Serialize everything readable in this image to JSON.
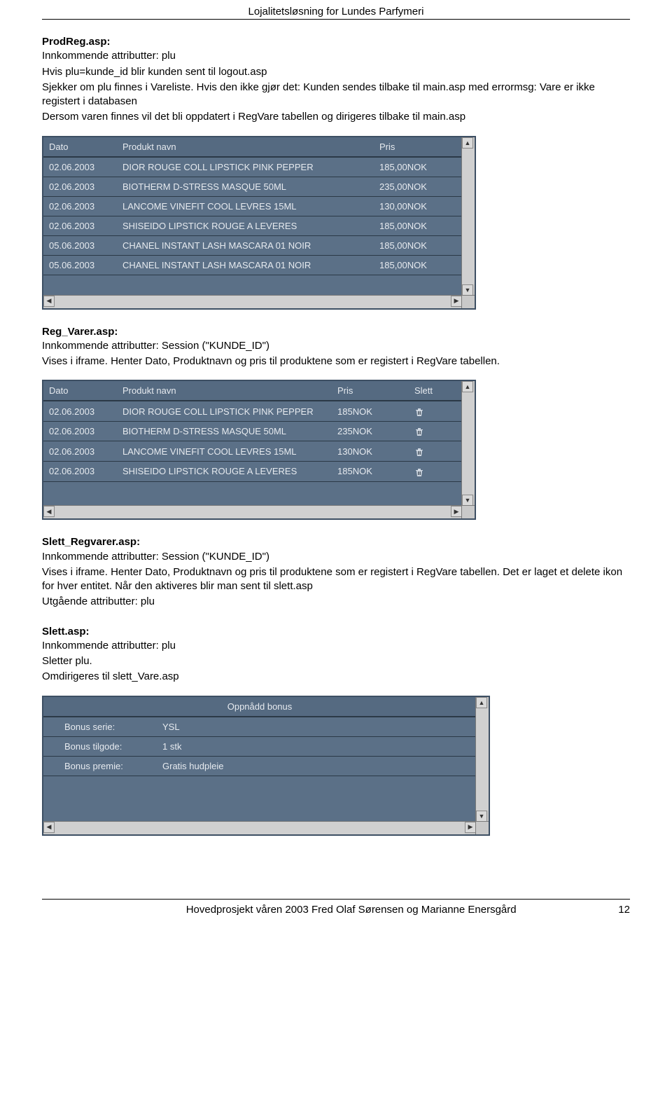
{
  "header": {
    "title": "Lojalitetsløsning for Lundes Parfymeri"
  },
  "section1": {
    "title": "ProdReg.asp:",
    "lines": [
      "Innkommende attributter: plu",
      "Hvis plu=kunde_id blir kunden sent til logout.asp",
      "Sjekker om plu finnes i Vareliste. Hvis den ikke gjør det: Kunden sendes tilbake til main.asp med errormsg: Vare er ikke registert i databasen",
      "Dersom varen finnes vil det bli oppdatert i RegVare tabellen og dirigeres tilbake til main.asp"
    ]
  },
  "table1": {
    "headers": {
      "dato": "Dato",
      "navn": "Produkt navn",
      "pris": "Pris"
    },
    "rows": [
      {
        "dato": "02.06.2003",
        "navn": "DIOR ROUGE COLL LIPSTICK PINK PEPPER",
        "pris": "185,00NOK"
      },
      {
        "dato": "02.06.2003",
        "navn": "BIOTHERM D-STRESS MASQUE 50ML",
        "pris": "235,00NOK"
      },
      {
        "dato": "02.06.2003",
        "navn": "LANCOME VINEFIT COOL LEVRES 15ML",
        "pris": "130,00NOK"
      },
      {
        "dato": "02.06.2003",
        "navn": "SHISEIDO LIPSTICK ROUGE A LEVERES",
        "pris": "185,00NOK"
      },
      {
        "dato": "05.06.2003",
        "navn": "CHANEL INSTANT LASH MASCARA 01 NOIR",
        "pris": "185,00NOK"
      },
      {
        "dato": "05.06.2003",
        "navn": "CHANEL INSTANT LASH MASCARA 01 NOIR",
        "pris": "185,00NOK"
      }
    ]
  },
  "section2": {
    "title": "Reg_Varer.asp:",
    "lines": [
      "Innkommende attributter: Session (\"KUNDE_ID\")",
      "Vises i iframe. Henter Dato, Produktnavn og pris til produktene som er registert i RegVare tabellen."
    ]
  },
  "table2": {
    "headers": {
      "dato": "Dato",
      "navn": "Produkt navn",
      "pris": "Pris",
      "slett": "Slett"
    },
    "rows": [
      {
        "dato": "02.06.2003",
        "navn": "DIOR ROUGE COLL LIPSTICK PINK PEPPER",
        "pris": "185NOK"
      },
      {
        "dato": "02.06.2003",
        "navn": "BIOTHERM D-STRESS MASQUE 50ML",
        "pris": "235NOK"
      },
      {
        "dato": "02.06.2003",
        "navn": "LANCOME VINEFIT COOL LEVRES 15ML",
        "pris": "130NOK"
      },
      {
        "dato": "02.06.2003",
        "navn": "SHISEIDO LIPSTICK ROUGE A LEVERES",
        "pris": "185NOK"
      }
    ]
  },
  "section3": {
    "title": "Slett_Regvarer.asp:",
    "lines": [
      "Innkommende attributter: Session (\"KUNDE_ID\")",
      "Vises i iframe. Henter Dato, Produktnavn og pris til produktene som er registert i RegVare tabellen. Det er laget et delete ikon for hver entitet. Når den aktiveres blir man sent til slett.asp",
      "Utgående attributter: plu"
    ]
  },
  "section4": {
    "title": "Slett.asp:",
    "lines": [
      "Innkommende attributter: plu",
      "Sletter plu.",
      "Omdirigeres til slett_Vare.asp"
    ]
  },
  "table3": {
    "title": "Oppnådd bonus",
    "rows": [
      {
        "label": "Bonus serie:",
        "value": "YSL"
      },
      {
        "label": "Bonus tilgode:",
        "value": "1 stk"
      },
      {
        "label": "Bonus premie:",
        "value": "Gratis hudpleie"
      }
    ]
  },
  "footer": {
    "left": "Hovedprosjekt våren 2003 Fred Olaf Sørensen og Marianne Enersgård",
    "right": "12"
  }
}
